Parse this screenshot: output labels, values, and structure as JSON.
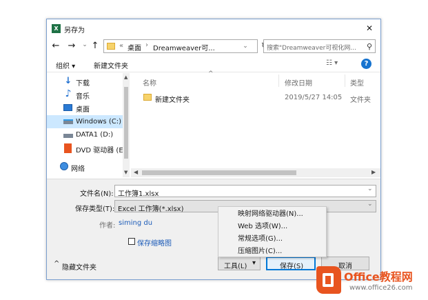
{
  "window": {
    "title": "另存为",
    "close_glyph": "✕"
  },
  "nav": {
    "back_glyph": "←",
    "forward_glyph": "→",
    "recent_glyph": "⌄",
    "up_glyph": "↑",
    "path_chevron": "«",
    "path_separator": "›",
    "path": [
      "桌面",
      "Dreamweaver可..."
    ],
    "refresh_glyph": "↻",
    "search_placeholder": "搜索\"Dreamweaver可视化网...",
    "search_glyph": "⚲"
  },
  "toolbar": {
    "organize": "组织 ▾",
    "new_folder": "新建文件夹",
    "view_glyph": "☷ ▾",
    "help_glyph": "?"
  },
  "sidebar": {
    "items": [
      {
        "label": "下载",
        "icon": "download-icon"
      },
      {
        "label": "音乐",
        "icon": "music-icon"
      },
      {
        "label": "桌面",
        "icon": "desktop-icon"
      },
      {
        "label": "Windows (C:)",
        "icon": "drive-icon",
        "selected": true
      },
      {
        "label": "DATA1 (D:)",
        "icon": "drive-icon"
      },
      {
        "label": "DVD 驱动器 (E:)",
        "icon": "office-icon"
      },
      {
        "label": "网络",
        "icon": "network-icon"
      }
    ]
  },
  "columns": {
    "name": "名称",
    "date": "修改日期",
    "type": "类型",
    "sort_glyph": "^"
  },
  "files": [
    {
      "name": "新建文件夹",
      "date": "2019/5/27 14:05",
      "type": "文件夹"
    }
  ],
  "form": {
    "filename_label": "文件名(N):",
    "filename_value": "工作簿1.xlsx",
    "filetype_label": "保存类型(T):",
    "filetype_value": "Excel 工作簿(*.xlsx)",
    "author_label": "作者:",
    "author_value": "siming du",
    "thumbnail_label": "保存缩略图"
  },
  "footer": {
    "hide_folders": "隐藏文件夹",
    "hide_glyph": "^",
    "tools": "工具(L)",
    "tools_glyph": "▾",
    "save": "保存(S)",
    "cancel": "取消"
  },
  "tools_menu": [
    "映射网络驱动器(N)...",
    "Web 选项(W)...",
    "常规选项(G)...",
    "压缩图片(C)..."
  ],
  "watermark": {
    "brand": "Office教程网",
    "url": "www.office26.com"
  },
  "colors": {
    "accent": "#0078d7",
    "selected": "#cce8ff",
    "excel": "#1e7145",
    "office_orange": "#e8541f",
    "link": "#1c5bb8"
  }
}
